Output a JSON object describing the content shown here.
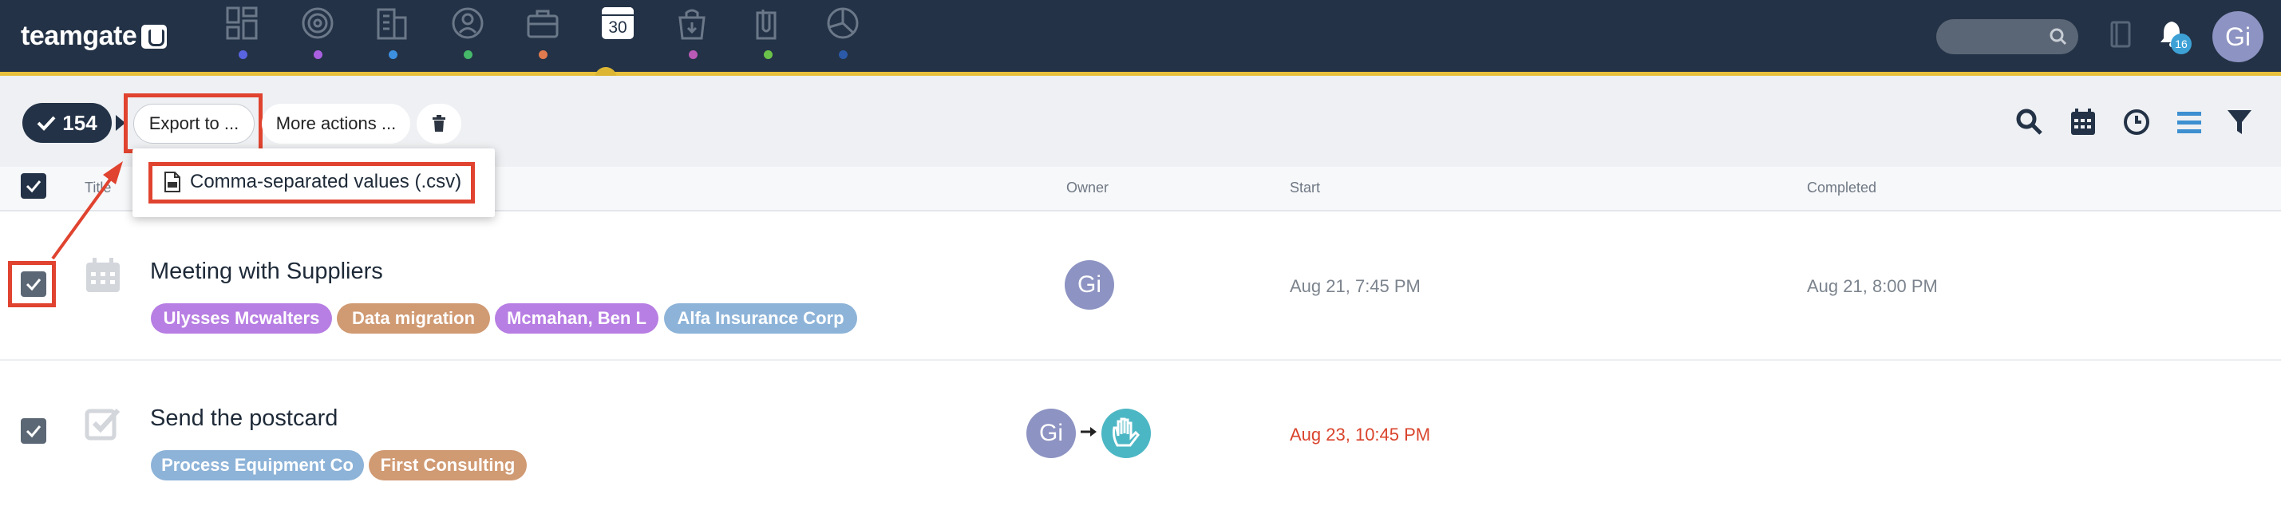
{
  "app": {
    "logo": "teamgate"
  },
  "nav": {
    "items": [
      {
        "icon": "dashboard-icon",
        "dot": "#5964e0"
      },
      {
        "icon": "target-icon",
        "dot": "#a960e0"
      },
      {
        "icon": "building-icon",
        "dot": "#3d8fe0"
      },
      {
        "icon": "person-icon",
        "dot": "#45b86a"
      },
      {
        "icon": "briefcase-icon",
        "dot": "#e07b4f"
      },
      {
        "icon": "calendar-icon",
        "dot": "",
        "label": "30",
        "active": true
      },
      {
        "icon": "bag-icon",
        "dot": "#b95ab6"
      },
      {
        "icon": "paperclip-icon",
        "dot": "#6bc24a"
      },
      {
        "icon": "pie-chart-icon",
        "dot": "#2b5aa8"
      }
    ],
    "notifications_count": "16",
    "user_initials": "Gi"
  },
  "toolbar": {
    "selected_count": "154",
    "export_label": "Export to ...",
    "more_actions_label": "More actions ...",
    "view_icons": [
      "search-icon",
      "calendar-view-icon",
      "clock-icon",
      "list-view-icon",
      "filter-icon"
    ]
  },
  "dropdown": {
    "items": [
      {
        "label": "Comma-separated values (.csv)",
        "icon": "csv-file-icon"
      }
    ]
  },
  "table": {
    "headers": {
      "title": "Title",
      "owner": "Owner",
      "start": "Start",
      "completed": "Completed"
    },
    "rows": [
      {
        "type_icon": "calendar-icon",
        "title": "Meeting with Suppliers",
        "tags": [
          {
            "label": "Ulysses Mcwalters",
            "color": "#b77ee3"
          },
          {
            "label": "Data migration",
            "color": "#d09a73"
          },
          {
            "label": "Mcmahan, Ben L",
            "color": "#b77ee3"
          },
          {
            "label": "Alfa Insurance Corp",
            "color": "#8db3d8"
          }
        ],
        "owner_initials": "Gi",
        "start": "Aug 21, 7:45 PM",
        "completed": "Aug 21, 8:00 PM"
      },
      {
        "type_icon": "task-check-icon",
        "title": "Send the postcard",
        "tags": [
          {
            "label": "Process Equipment Co",
            "color": "#8db3d8"
          },
          {
            "label": "First Consulting",
            "color": "#d09a73"
          }
        ],
        "owner_initials": "Gi",
        "start": "Aug 23, 10:45 PM",
        "completed": ""
      }
    ]
  },
  "colors": {
    "nav_bg": "#233246",
    "accent": "#e9c03c",
    "highlight": "#e0432f",
    "overdue": "#d9442d"
  }
}
